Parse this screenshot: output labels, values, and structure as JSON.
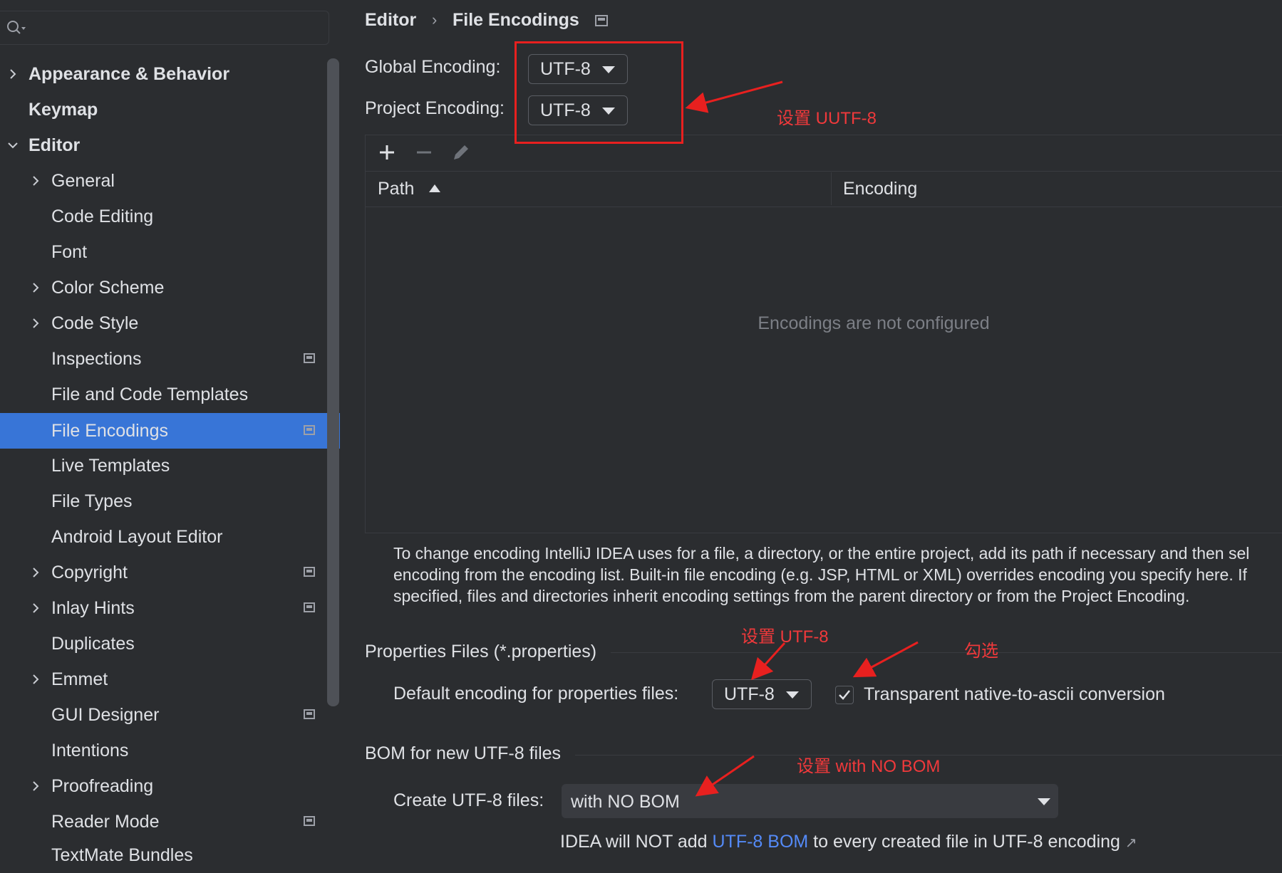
{
  "sidebar": {
    "search_placeholder": "",
    "items": [
      {
        "label": "Appearance & Behavior"
      },
      {
        "label": "Keymap"
      },
      {
        "label": "Editor"
      },
      {
        "label": "General"
      },
      {
        "label": "Code Editing"
      },
      {
        "label": "Font"
      },
      {
        "label": "Color Scheme"
      },
      {
        "label": "Code Style"
      },
      {
        "label": "Inspections"
      },
      {
        "label": "File and Code Templates"
      },
      {
        "label": "File Encodings"
      },
      {
        "label": "Live Templates"
      },
      {
        "label": "File Types"
      },
      {
        "label": "Android Layout Editor"
      },
      {
        "label": "Copyright"
      },
      {
        "label": "Inlay Hints"
      },
      {
        "label": "Duplicates"
      },
      {
        "label": "Emmet"
      },
      {
        "label": "GUI Designer"
      },
      {
        "label": "Intentions"
      },
      {
        "label": "Proofreading"
      },
      {
        "label": "Reader Mode"
      },
      {
        "label": "TextMate Bundles"
      }
    ]
  },
  "breadcrumb": {
    "parent": "Editor",
    "separator": "›",
    "current": "File Encodings"
  },
  "encoding": {
    "global_label": "Global Encoding:",
    "global_value": "UTF-8",
    "project_label": "Project Encoding:",
    "project_value": "UTF-8"
  },
  "table": {
    "col_path": "Path",
    "col_encoding": "Encoding",
    "empty_text": "Encodings are not configured"
  },
  "description": {
    "line1": "To change encoding IntelliJ IDEA uses for a file, a directory, or the entire project, add its path if necessary and then sel",
    "line2": "encoding from the encoding list. Built-in file encoding (e.g. JSP, HTML or XML) overrides encoding you specify here. If",
    "line3": "specified, files and directories inherit encoding settings from the parent directory or from the Project Encoding."
  },
  "properties": {
    "section_title": "Properties Files (*.properties)",
    "default_label": "Default encoding for properties files:",
    "default_value": "UTF-8",
    "transparent_label": "Transparent native-to-ascii conversion",
    "transparent_checked": true
  },
  "bom": {
    "section_title": "BOM for new UTF-8 files",
    "create_label": "Create UTF-8 files:",
    "create_value": "with NO BOM",
    "note_prefix": "IDEA will NOT add ",
    "note_link": "UTF-8 BOM",
    "note_suffix": " to every created file in UTF-8 encoding",
    "note_arrow": "↗"
  },
  "annotations": {
    "a1": "设置 UUTF-8",
    "a2": "设置 UTF-8",
    "a3": "勾选",
    "a4": "设置 with NO BOM",
    "color": "#e8201f"
  },
  "colors": {
    "background": "#2b2d30",
    "selection": "#3875d7",
    "link": "#548af7"
  }
}
